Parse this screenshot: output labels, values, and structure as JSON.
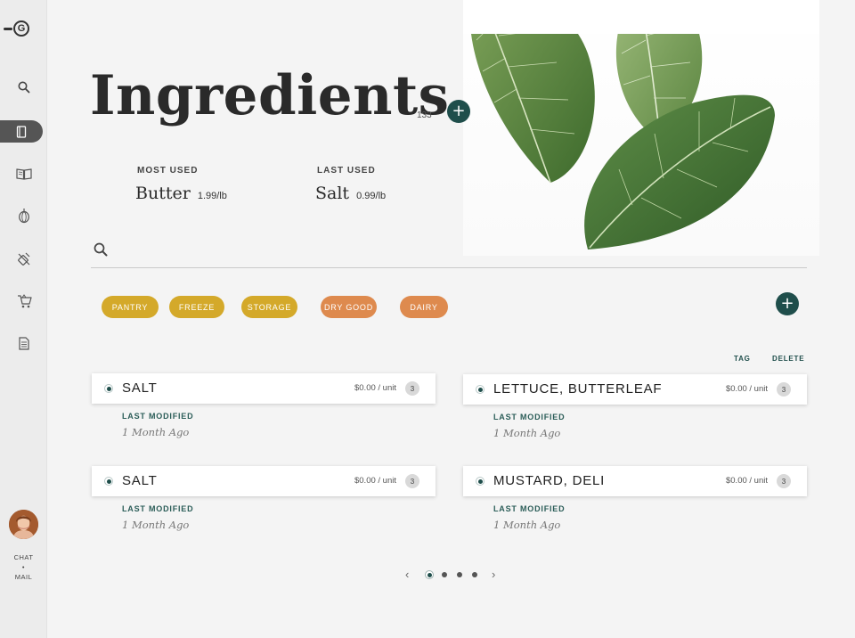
{
  "app": {
    "logo_letter": "G"
  },
  "sidebar": {
    "chat_label": "CHAT",
    "separator": "•",
    "mail_label": "MAIL"
  },
  "header": {
    "title": "Ingredients",
    "count": "133",
    "add_symbol": "+"
  },
  "stats": {
    "most_used": {
      "label": "MOST USED",
      "item": "Butter",
      "price": "1.99/lb"
    },
    "last_used": {
      "label": "LAST USED",
      "item": "Salt",
      "price": "0.99/lb"
    }
  },
  "search": {
    "value": "",
    "placeholder": ""
  },
  "tags": [
    {
      "label": "PANTRY",
      "color": "#d4a92a"
    },
    {
      "label": "FREEZE",
      "color": "#d4a92a"
    },
    {
      "label": "STORAGE",
      "color": "#d4a92a"
    },
    {
      "label": "DRY GOOD",
      "color": "#de8a4e"
    },
    {
      "label": "DAIRY",
      "color": "#de8a4e"
    }
  ],
  "tag_add_symbol": "+",
  "actions": {
    "tag": "TAG",
    "delete": "DELETE"
  },
  "ingredients": [
    {
      "name": "SALT",
      "price": "$0.00 / unit",
      "qty": "3",
      "meta_label": "LAST MODIFIED",
      "modified": "1 Month Ago"
    },
    {
      "name": "LETTUCE, BUTTERLEAF",
      "price": "$0.00 / unit",
      "qty": "3",
      "meta_label": "LAST MODIFIED",
      "modified": "1 Month Ago"
    },
    {
      "name": "SALT",
      "price": "$0.00 / unit",
      "qty": "3",
      "meta_label": "LAST MODIFIED",
      "modified": "1 Month Ago"
    },
    {
      "name": "MUSTARD, DELI",
      "price": "$0.00 / unit",
      "qty": "3",
      "meta_label": "LAST MODIFIED",
      "modified": "1 Month Ago"
    }
  ],
  "pagination": {
    "prev": "‹",
    "next": "›",
    "pages": 4,
    "current": 1
  },
  "colors": {
    "accent": "#1f4e4b",
    "tag_yellow": "#d4a92a",
    "tag_orange": "#de8a4e"
  }
}
